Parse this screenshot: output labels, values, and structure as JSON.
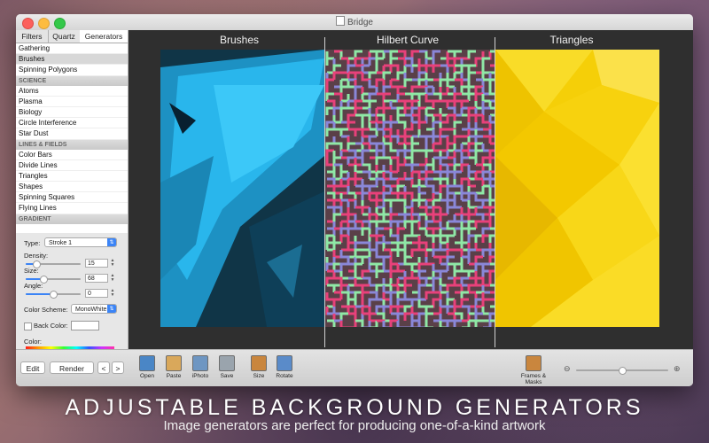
{
  "window": {
    "title": "Bridge"
  },
  "sidebar": {
    "tabs": [
      {
        "label": "Filters"
      },
      {
        "label": "Quartz"
      },
      {
        "label": "Generators"
      }
    ],
    "groups": [
      {
        "name": "",
        "items": [
          "Gathering",
          "Brushes",
          "Spinning Polygons"
        ]
      },
      {
        "name": "SCIENCE",
        "items": [
          "Atoms",
          "Plasma",
          "Biology",
          "Circle Interference",
          "Star Dust"
        ]
      },
      {
        "name": "LINES & FIELDS",
        "items": [
          "Color Bars",
          "Divide Lines",
          "Triangles",
          "Shapes",
          "Spinning Squares",
          "Flying Lines"
        ]
      },
      {
        "name": "GRADIENT",
        "items": []
      }
    ],
    "selected_item": "Brushes"
  },
  "inspector": {
    "type_label": "Type:",
    "type_value": "Stroke 1",
    "density_label": "Density:",
    "density_value": "15",
    "density_level": 0.2,
    "size_label": "Size:",
    "size_value": "68",
    "size_level": 0.32,
    "angle_label": "Angle:",
    "angle_value": "0",
    "angle_level": 0.5,
    "scheme_label": "Color Scheme:",
    "scheme_value": "MonoWhite",
    "backcolor_label": "Back Color:",
    "backcolor_checked": false,
    "color_label": "Color:",
    "color_position": 0.6
  },
  "toolbar": {
    "edit_label": "Edit",
    "render_label": "Render",
    "prev_label": "<",
    "next_label": ">",
    "tools": [
      {
        "label": "Open",
        "icon": "open-icon",
        "color": "#4a86c6"
      },
      {
        "label": "Paste",
        "icon": "paste-icon",
        "color": "#d9a85b"
      },
      {
        "label": "iPhoto",
        "icon": "iphoto-icon",
        "color": "#6e96c2"
      },
      {
        "label": "Save",
        "icon": "save-icon",
        "color": "#9aa4ad"
      },
      {
        "label": "Size",
        "icon": "size-icon",
        "color": "#c9863e"
      },
      {
        "label": "Rotate",
        "icon": "rotate-icon",
        "color": "#5a8bc9"
      }
    ],
    "frames_label": "Frames & Masks",
    "zoom_level": 0.5
  },
  "canvas": {
    "panels": [
      {
        "title": "Brushes",
        "color": "#29b6ec"
      },
      {
        "title": "Hilbert Curve",
        "colors": [
          "#e8417a",
          "#8fe8a6",
          "#8a87d8",
          "#5a4048"
        ]
      },
      {
        "title": "Triangles",
        "color": "#f7d40a"
      }
    ]
  },
  "caption": {
    "headline": "ADJUSTABLE BACKGROUND GENERATORS",
    "subline": "Image generators are perfect for producing one-of-a-kind artwork"
  }
}
